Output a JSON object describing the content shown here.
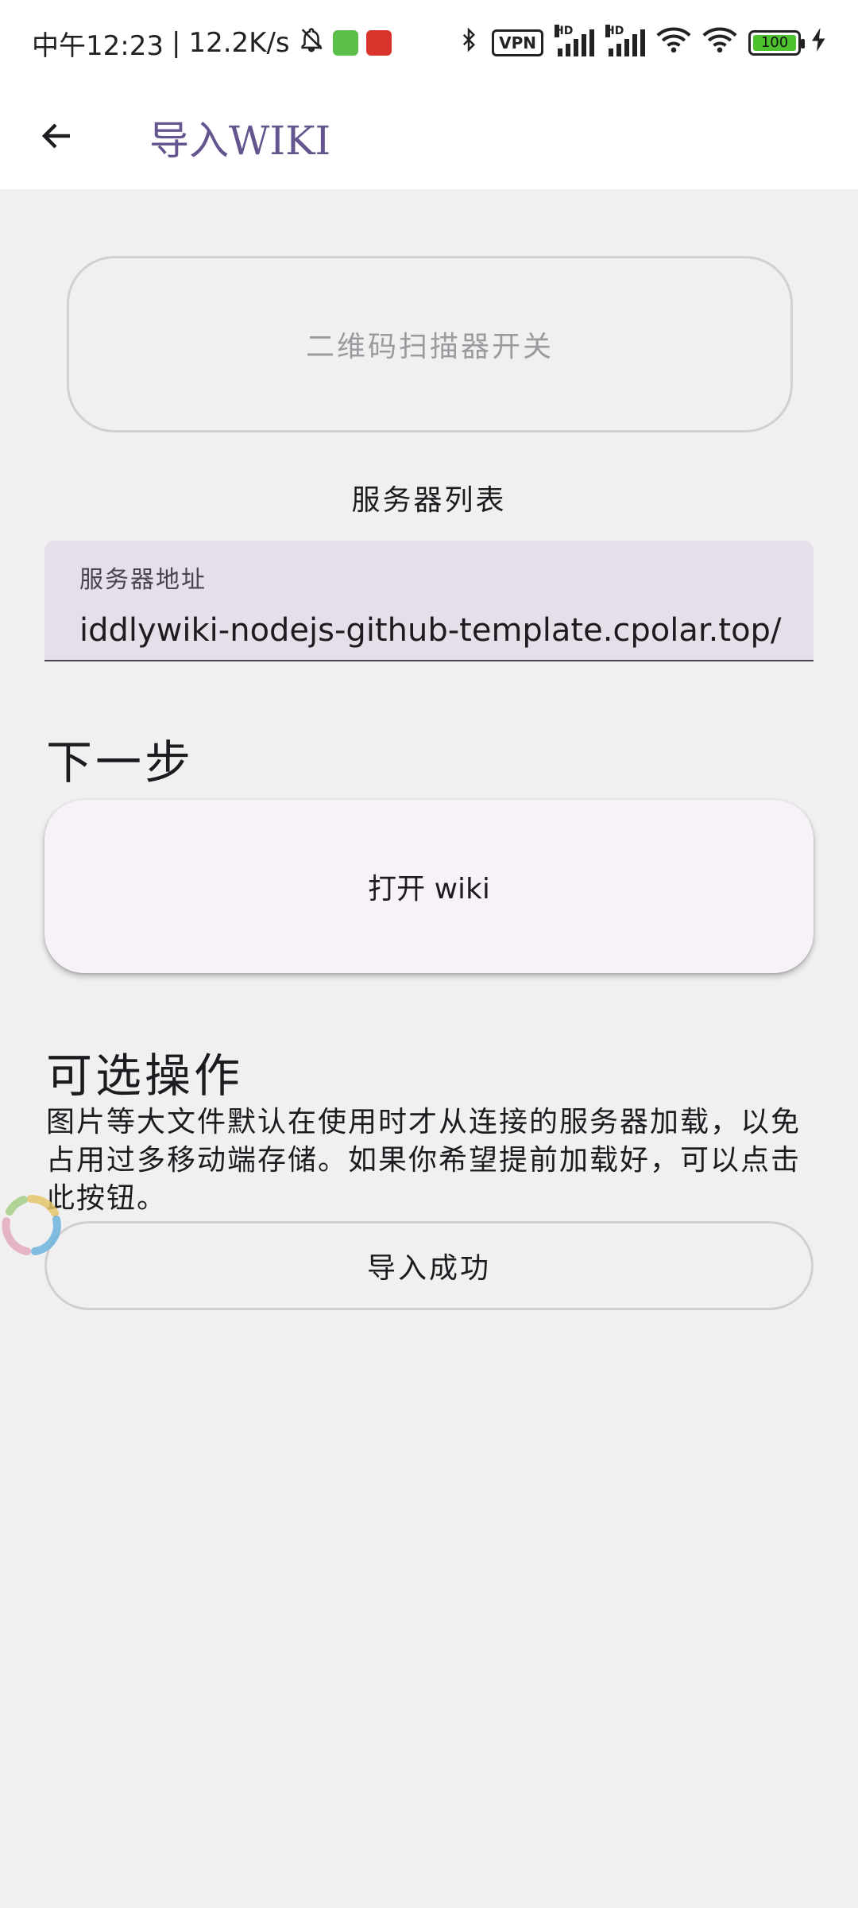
{
  "status_bar": {
    "time": "中午12:23",
    "separator": "|",
    "net_speed": "12.2K/s",
    "icons": [
      "bell-off-icon",
      "app-notification-icon",
      "app-notification-icon",
      "bluetooth-icon",
      "vpn-icon",
      "signal-icon",
      "signal-icon",
      "wifi-icon",
      "wifi-icon",
      "battery-icon",
      "charging-icon"
    ],
    "vpn_label": "VPN",
    "hd_label": "HD",
    "battery_level": "100"
  },
  "app_bar": {
    "back_icon": "arrow-left-icon",
    "title": "导入WIKI"
  },
  "scanner_toggle_label": "二维码扫描器开关",
  "server_list_label": "服务器列表",
  "server_field": {
    "label": "服务器地址",
    "value": "iddlywiki-nodejs-github-template.cpolar.top/"
  },
  "next_step": {
    "title": "下一步",
    "open_wiki_label": "打开 wiki"
  },
  "optional": {
    "title": "可选操作",
    "description": "图片等大文件默认在使用时才从连接的服务器加载，以免占用过多移动端存储。如果你希望提前加载好，可以点击此按钮。",
    "import_button_label": "导入成功"
  },
  "colors": {
    "accent": "#65558f",
    "field_bg": "#e6dfea",
    "page_bg": "#f1f0f1",
    "battery": "#4cc22e"
  }
}
